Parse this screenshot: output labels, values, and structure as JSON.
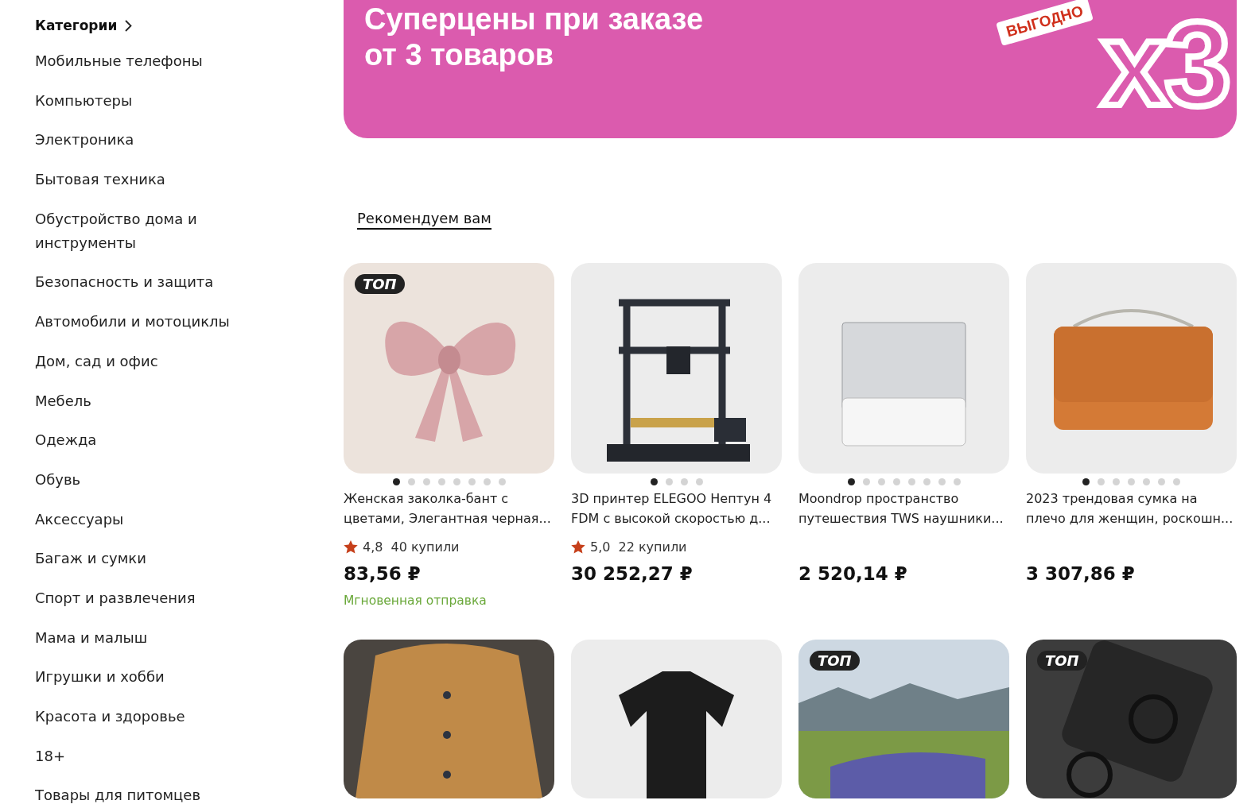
{
  "sidebar": {
    "heading": "Категории",
    "items": [
      "Мобильные телефоны",
      "Компьютеры",
      "Электроника",
      "Бытовая техника",
      "Обустройство дома и инструменты",
      "Безопасность и защита",
      "Автомобили и мотоциклы",
      "Дом, сад и офис",
      "Мебель",
      "Одежда",
      "Обувь",
      "Аксессуары",
      "Багаж и сумки",
      "Спорт и развлечения",
      "Мама и малыш",
      "Игрушки и хобби",
      "Красота и здоровье",
      "18+",
      "Товары для питомцев"
    ]
  },
  "banner": {
    "title": "Суперцены при заказе\nот 3 товаров",
    "sticker": "ВЫГОДНО",
    "multiplier": "x3"
  },
  "section": {
    "title": "Рекомендуем вам",
    "selected": true
  },
  "products": [
    {
      "kind": "bow",
      "badge": "ТОП",
      "dots": [
        {
          "selected": true
        },
        {
          "selected": false
        },
        {
          "selected": false
        },
        {
          "selected": false
        },
        {
          "selected": false
        },
        {
          "selected": false
        },
        {
          "selected": false
        },
        {
          "selected": false
        }
      ],
      "title": "Женская заколка-бант с цветами, Элегантная черная...",
      "rating": "4,8",
      "bought": "40 купили",
      "price": "83,56 ₽",
      "shipping": "Мгновенная отправка"
    },
    {
      "kind": "printer",
      "dots": [
        {
          "selected": true
        },
        {
          "selected": false
        },
        {
          "selected": false
        },
        {
          "selected": false
        }
      ],
      "title": "3D принтер ELEGOO Нептун 4 FDM с высокой скоростью д...",
      "rating": "5,0",
      "bought": "22 купили",
      "price": "30 252,27 ₽"
    },
    {
      "kind": "earbuds",
      "dots": [
        {
          "selected": true
        },
        {
          "selected": false
        },
        {
          "selected": false
        },
        {
          "selected": false
        },
        {
          "selected": false
        },
        {
          "selected": false
        },
        {
          "selected": false
        },
        {
          "selected": false
        }
      ],
      "title": "Moondrop пространство путешествия TWS наушники...",
      "price": "2 520,14 ₽"
    },
    {
      "kind": "bag",
      "dots": [
        {
          "selected": true
        },
        {
          "selected": false
        },
        {
          "selected": false
        },
        {
          "selected": false
        },
        {
          "selected": false
        },
        {
          "selected": false
        },
        {
          "selected": false
        }
      ],
      "title": "2023 трендовая сумка на плечо для женщин, роскошн...",
      "price": "3 307,86 ₽"
    },
    {
      "kind": "sweater"
    },
    {
      "kind": "romper"
    },
    {
      "kind": "landscape",
      "badge": "ТОП"
    },
    {
      "kind": "phones",
      "badge": "ТОП"
    }
  ]
}
